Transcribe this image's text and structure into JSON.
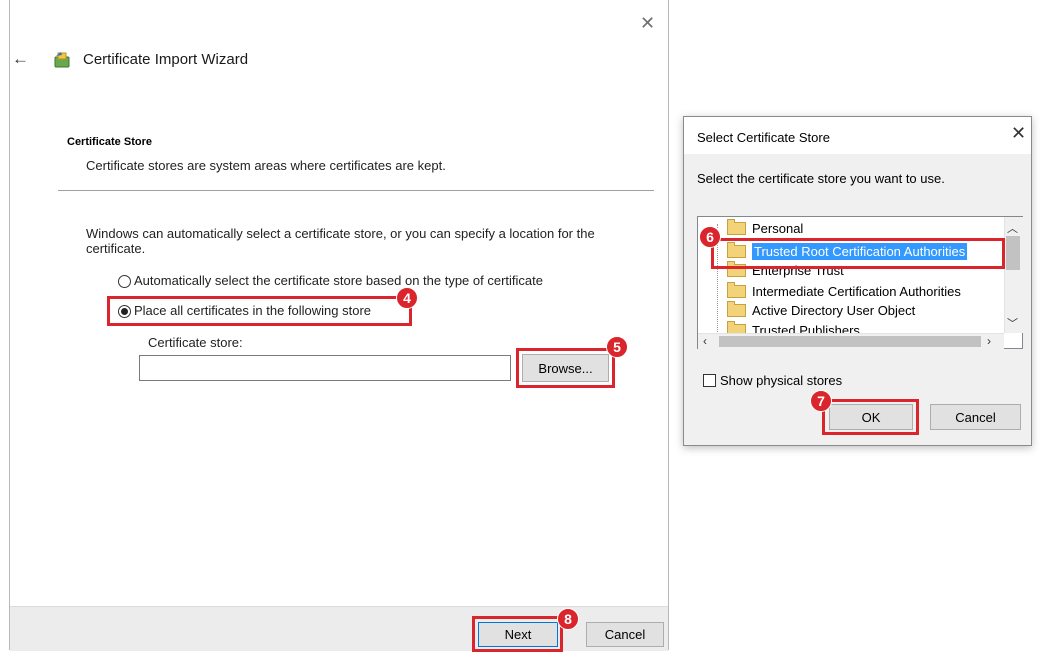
{
  "wizard": {
    "title": "Certificate Import Wizard",
    "section_title": "Certificate Store",
    "section_description": "Certificate stores are system areas where certificates are kept.",
    "intro": "Windows can automatically select a certificate store, or you can specify a location for the certificate.",
    "radio_auto_label": "Automatically select the certificate store based on the type of certificate",
    "radio_place_label": "Place all certificates in the following store",
    "selected_option": "place",
    "store_label": "Certificate store:",
    "store_value": "",
    "browse_label": "Browse...",
    "next_label": "Next",
    "cancel_label": "Cancel"
  },
  "dialog": {
    "title": "Select Certificate Store",
    "prompt": "Select the certificate store you want to use.",
    "stores": [
      "Personal",
      "Trusted Root Certification Authorities",
      "Enterprise Trust",
      "Intermediate Certification Authorities",
      "Active Directory User Object",
      "Trusted Publishers"
    ],
    "selected_store": "Trusted Root Certification Authorities",
    "show_physical_label": "Show physical stores",
    "show_physical_checked": false,
    "ok_label": "OK",
    "cancel_label": "Cancel"
  },
  "annotations": {
    "highlight_color": "#d9252b",
    "badges": [
      "4",
      "5",
      "6",
      "7",
      "8"
    ]
  },
  "icons": {
    "back": "back-arrow-icon",
    "wizard": "certificate-wizard-icon",
    "close": "close-icon",
    "folder": "folder-icon"
  }
}
